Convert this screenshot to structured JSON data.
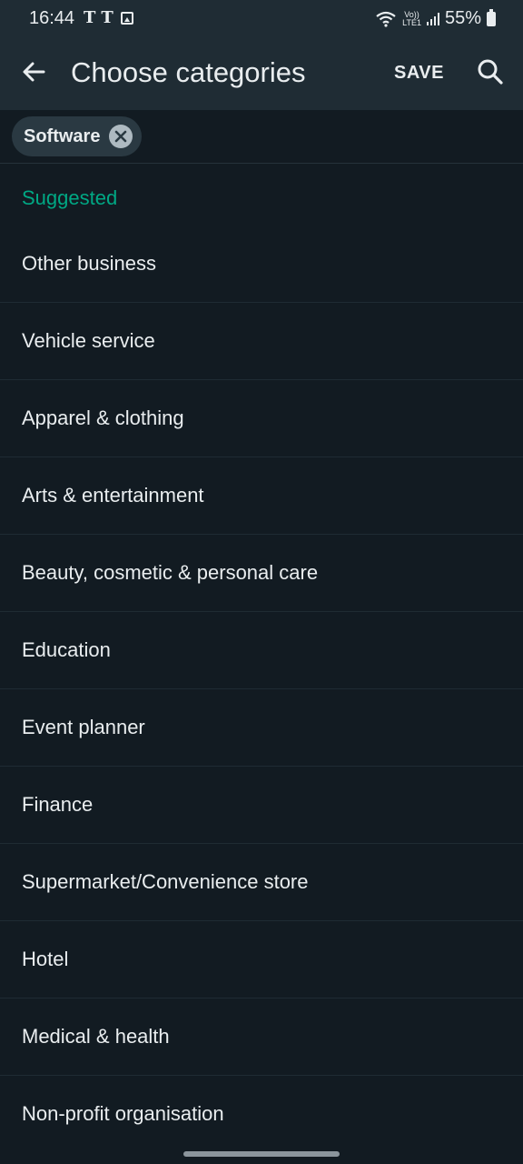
{
  "status_bar": {
    "time": "16:44",
    "left_icons": [
      "T",
      "T"
    ],
    "volte_line1": "Vo))",
    "volte_line2": "LTE1",
    "battery": "55%"
  },
  "app_bar": {
    "title": "Choose categories",
    "save_label": "SAVE",
    "back_icon": "arrow-back-icon",
    "search_icon": "search-icon"
  },
  "selected_chips": [
    {
      "label": "Software"
    }
  ],
  "suggested_header": "Suggested",
  "categories": [
    {
      "label": "Other business"
    },
    {
      "label": "Vehicle service"
    },
    {
      "label": "Apparel & clothing"
    },
    {
      "label": "Arts & entertainment"
    },
    {
      "label": "Beauty, cosmetic & personal care"
    },
    {
      "label": "Education"
    },
    {
      "label": "Event planner"
    },
    {
      "label": "Finance"
    },
    {
      "label": "Supermarket/Convenience store"
    },
    {
      "label": "Hotel"
    },
    {
      "label": "Medical & health"
    },
    {
      "label": "Non-profit organisation"
    }
  ],
  "colors": {
    "background": "#121b22",
    "app_bar": "#1f2c34",
    "accent": "#00a884",
    "text": "#e9edef"
  }
}
